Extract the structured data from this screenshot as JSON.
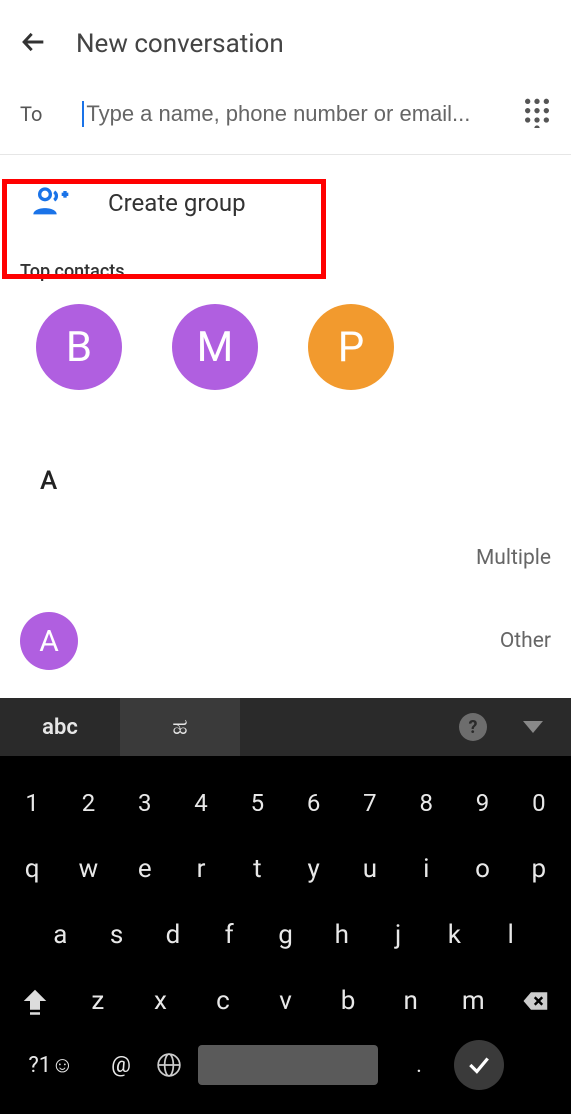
{
  "header": {
    "title": "New conversation"
  },
  "to": {
    "label": "To",
    "placeholder": "Type a name, phone number or email..."
  },
  "create_group": {
    "label": "Create group"
  },
  "top_contacts": {
    "label": "Top contacts",
    "avatars": [
      {
        "initial": "B",
        "color": "purple"
      },
      {
        "initial": "M",
        "color": "purple"
      },
      {
        "initial": "P",
        "color": "orange"
      }
    ]
  },
  "sections": [
    {
      "letter": "A"
    }
  ],
  "contacts": [
    {
      "meta": "Multiple"
    },
    {
      "avatar_initial": "A",
      "avatar_color": "purple",
      "meta": "Other"
    }
  ],
  "keyboard": {
    "tab_active": "abc",
    "tab_secondary": "ಹ",
    "num_row": [
      "1",
      "2",
      "3",
      "4",
      "5",
      "6",
      "7",
      "8",
      "9",
      "0"
    ],
    "row1": [
      "q",
      "w",
      "e",
      "r",
      "t",
      "y",
      "u",
      "i",
      "o",
      "p"
    ],
    "row2": [
      "a",
      "s",
      "d",
      "f",
      "g",
      "h",
      "j",
      "k",
      "l"
    ],
    "row3": [
      "z",
      "x",
      "c",
      "v",
      "b",
      "n",
      "m"
    ],
    "bottom": {
      "symbols": "?1☺",
      "at": "@",
      "dot": "."
    }
  }
}
